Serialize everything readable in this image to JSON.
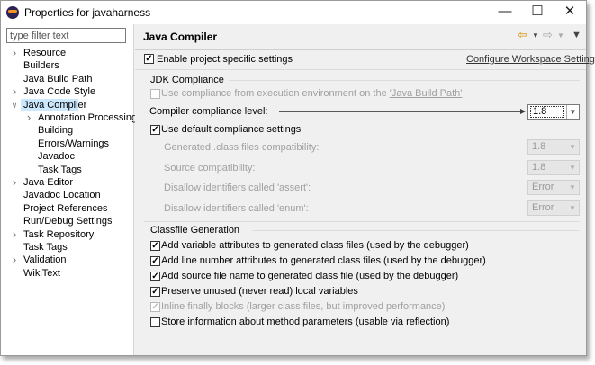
{
  "window": {
    "title": "Properties for javaharness"
  },
  "filter": {
    "placeholder": "type filter text"
  },
  "tree": [
    {
      "label": "Resource",
      "expandable": true
    },
    {
      "label": "Builders",
      "expandable": false
    },
    {
      "label": "Java Build Path",
      "expandable": false
    },
    {
      "label": "Java Code Style",
      "expandable": true
    },
    {
      "label": "Java Compiler",
      "expandable": true,
      "expanded": true,
      "selected": true
    },
    {
      "label": "Annotation Processing",
      "expandable": true,
      "child": true
    },
    {
      "label": "Building",
      "expandable": false,
      "child": true
    },
    {
      "label": "Errors/Warnings",
      "expandable": false,
      "child": true
    },
    {
      "label": "Javadoc",
      "expandable": false,
      "child": true
    },
    {
      "label": "Task Tags",
      "expandable": false,
      "child": true
    },
    {
      "label": "Java Editor",
      "expandable": true
    },
    {
      "label": "Javadoc Location",
      "expandable": false
    },
    {
      "label": "Project References",
      "expandable": false
    },
    {
      "label": "Run/Debug Settings",
      "expandable": false
    },
    {
      "label": "Task Repository",
      "expandable": true
    },
    {
      "label": "Task Tags",
      "expandable": false
    },
    {
      "label": "Validation",
      "expandable": true
    },
    {
      "label": "WikiText",
      "expandable": false
    }
  ],
  "page": {
    "title": "Java Compiler",
    "enable_specific": "Enable project specific settings",
    "configure_link": "Configure Workspace Settings..."
  },
  "jdk": {
    "group_title": "JDK Compliance",
    "use_ee_text": "Use compliance from execution environment on the ",
    "use_ee_link": "'Java Build Path'",
    "compliance_label": "Compiler compliance level:",
    "compliance_value": "1.8",
    "use_default": "Use default compliance settings",
    "rows": [
      {
        "label": "Generated .class files compatibility:",
        "value": "1.8"
      },
      {
        "label": "Source compatibility:",
        "value": "1.8"
      },
      {
        "label": "Disallow identifiers called 'assert':",
        "value": "Error"
      },
      {
        "label": "Disallow identifiers called 'enum':",
        "value": "Error"
      }
    ]
  },
  "classfile": {
    "group_title": "Classfile Generation",
    "items": [
      {
        "label": "Add variable attributes to generated class files (used by the debugger)",
        "checked": true,
        "enabled": true
      },
      {
        "label": "Add line number attributes to generated class files (used by the debugger)",
        "checked": true,
        "enabled": true
      },
      {
        "label": "Add source file name to generated class file (used by the debugger)",
        "checked": true,
        "enabled": true
      },
      {
        "label": "Preserve unused (never read) local variables",
        "checked": true,
        "enabled": true
      },
      {
        "label": "Inline finally blocks (larger class files, but improved performance)",
        "checked": true,
        "enabled": false
      },
      {
        "label": "Store information about method parameters (usable via reflection)",
        "checked": false,
        "enabled": true
      }
    ]
  },
  "colors": {
    "selection": "#cce8ff",
    "panel": "#f0f0f0",
    "disabled_text": "#a0a0a0"
  },
  "icons": {
    "back": "back-arrow-icon",
    "forward": "forward-arrow-icon",
    "menu": "view-menu-icon"
  }
}
